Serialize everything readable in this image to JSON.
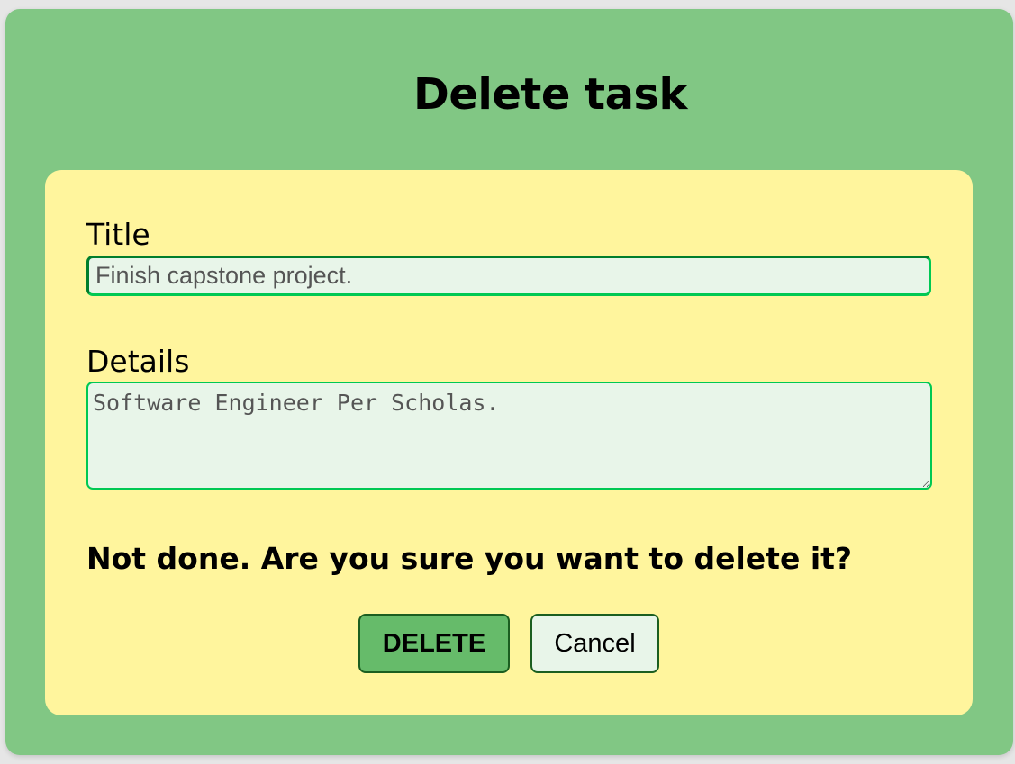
{
  "page": {
    "title": "Delete task"
  },
  "form": {
    "title_label": "Title",
    "title_value": "Finish capstone project.",
    "details_label": "Details",
    "details_value": "Software Engineer Per Scholas.",
    "confirm_text": "Not done. Are you sure you want to delete it?"
  },
  "actions": {
    "delete_label": "DELETE",
    "cancel_label": "Cancel"
  },
  "colors": {
    "outer_background": "#81c784",
    "card_background": "#fff59d",
    "input_background": "#e8f5e9",
    "input_border": "#00c853",
    "delete_button": "#66bb6a",
    "button_border": "#1b5e20"
  }
}
